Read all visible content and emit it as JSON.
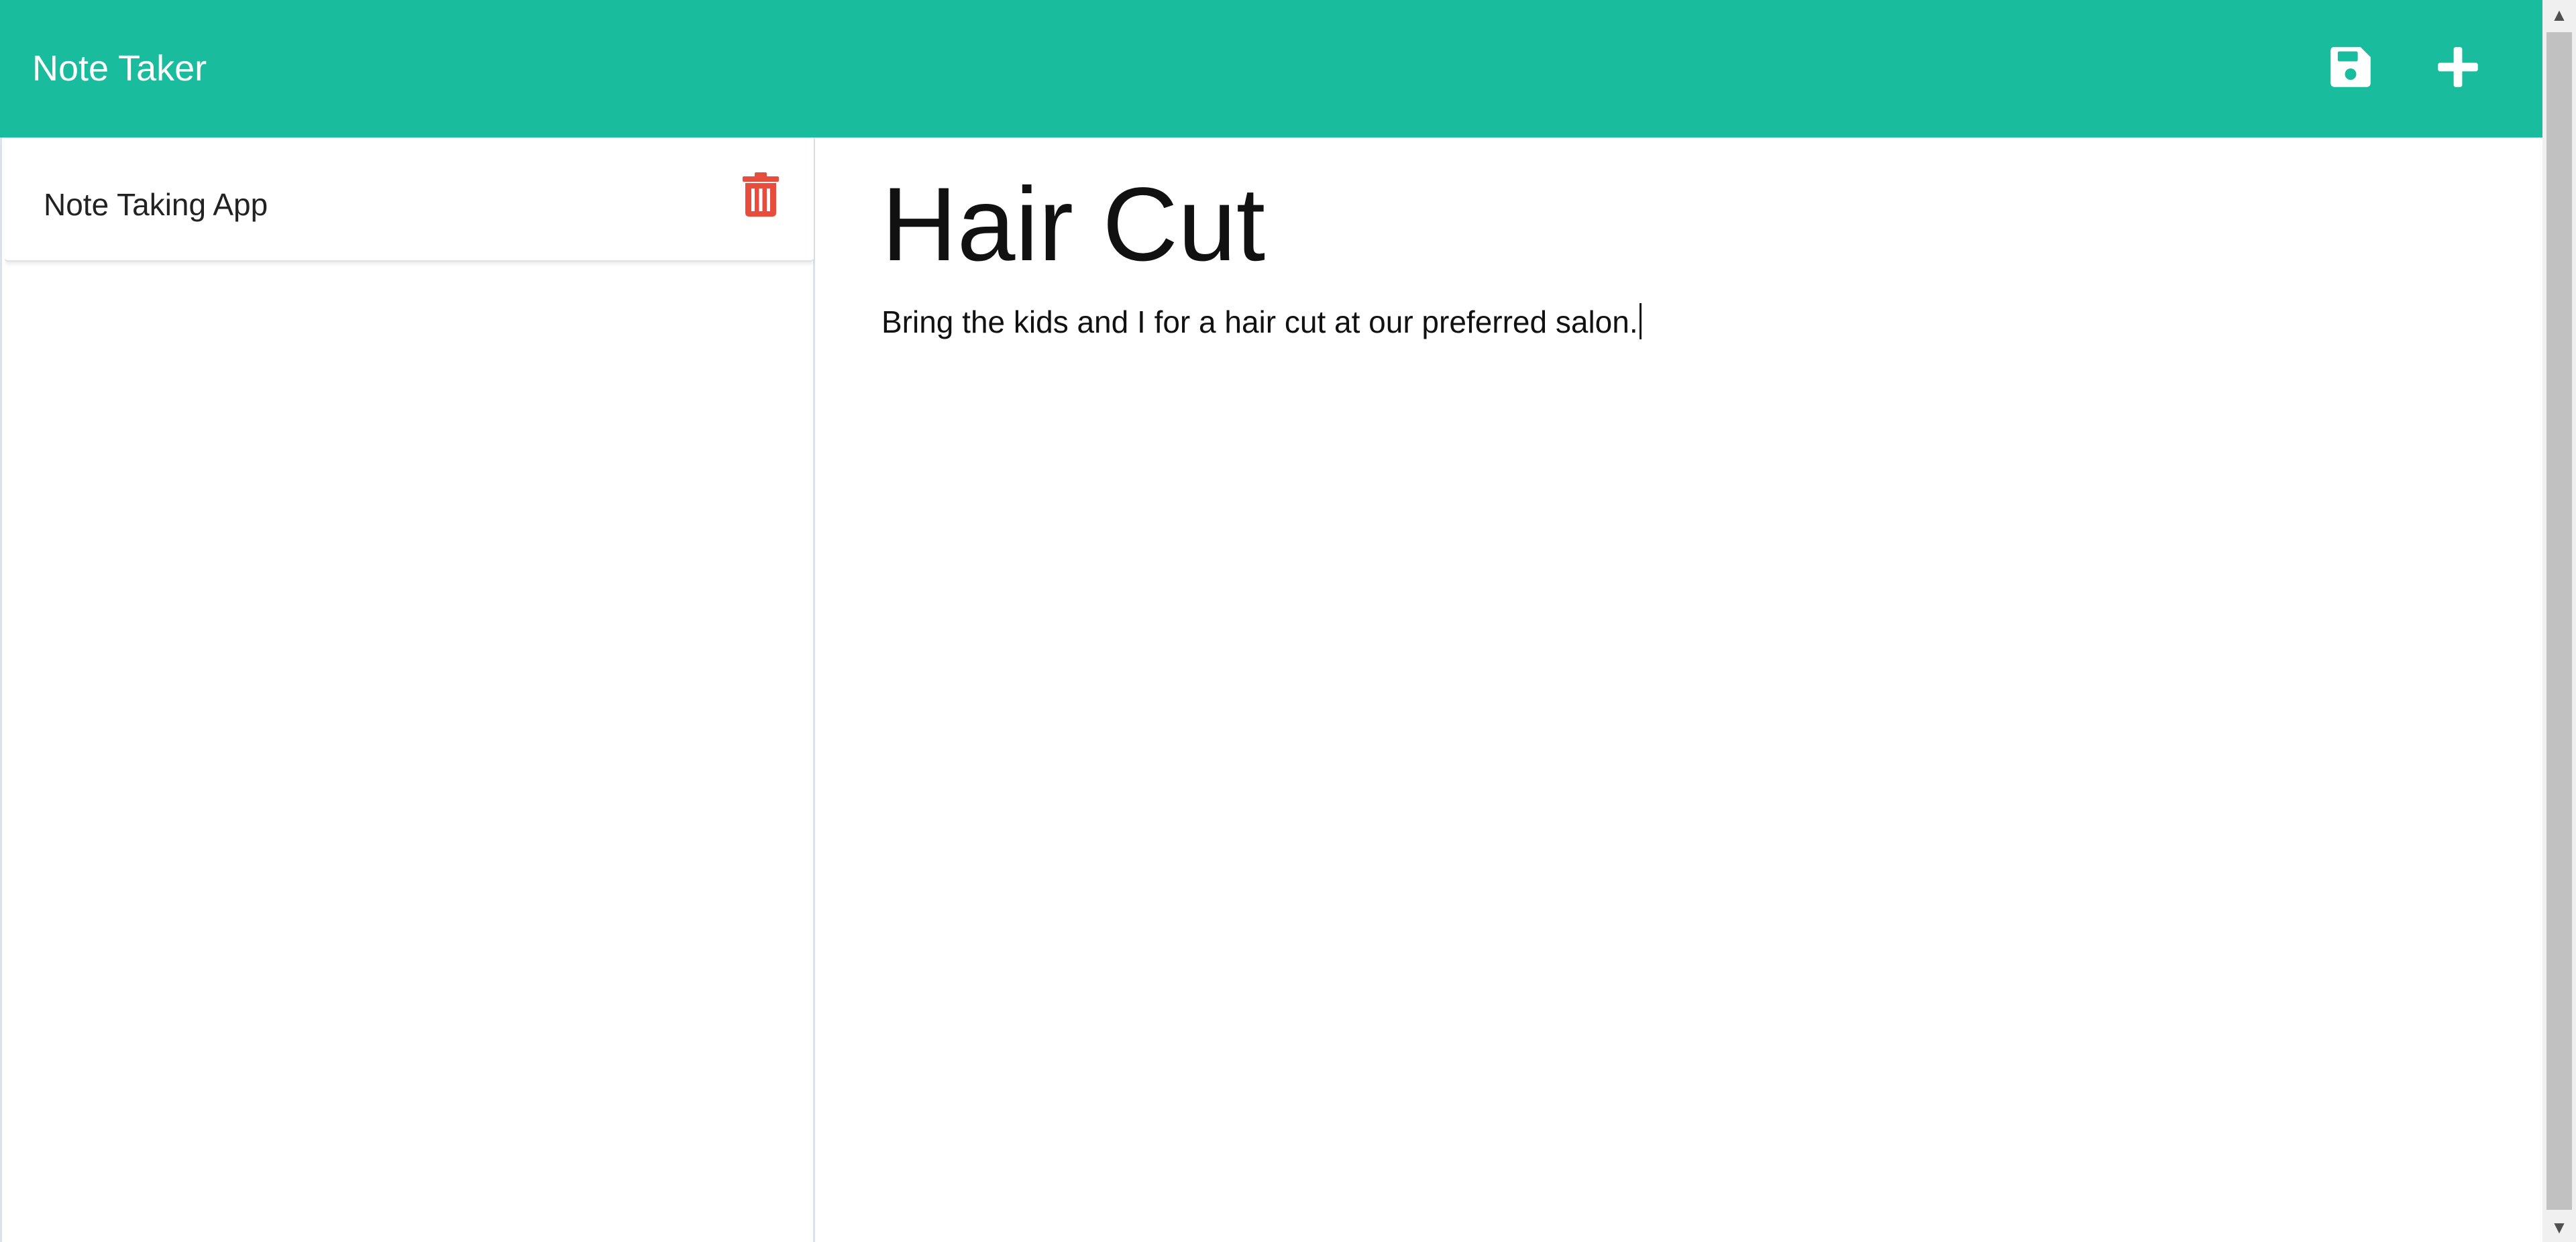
{
  "navbar": {
    "brand": "Note Taker",
    "save_icon": "floppy-disk-icon",
    "add_icon": "plus-icon",
    "color": "#19bc9c"
  },
  "sidebar": {
    "notes": [
      {
        "title": "Note Taking App",
        "delete_icon": "trash-icon"
      }
    ],
    "delete_color": "#e74c3c"
  },
  "editor": {
    "title": "Hair Cut",
    "text": "Bring the kids and I for a hair cut at our preferred salon."
  }
}
